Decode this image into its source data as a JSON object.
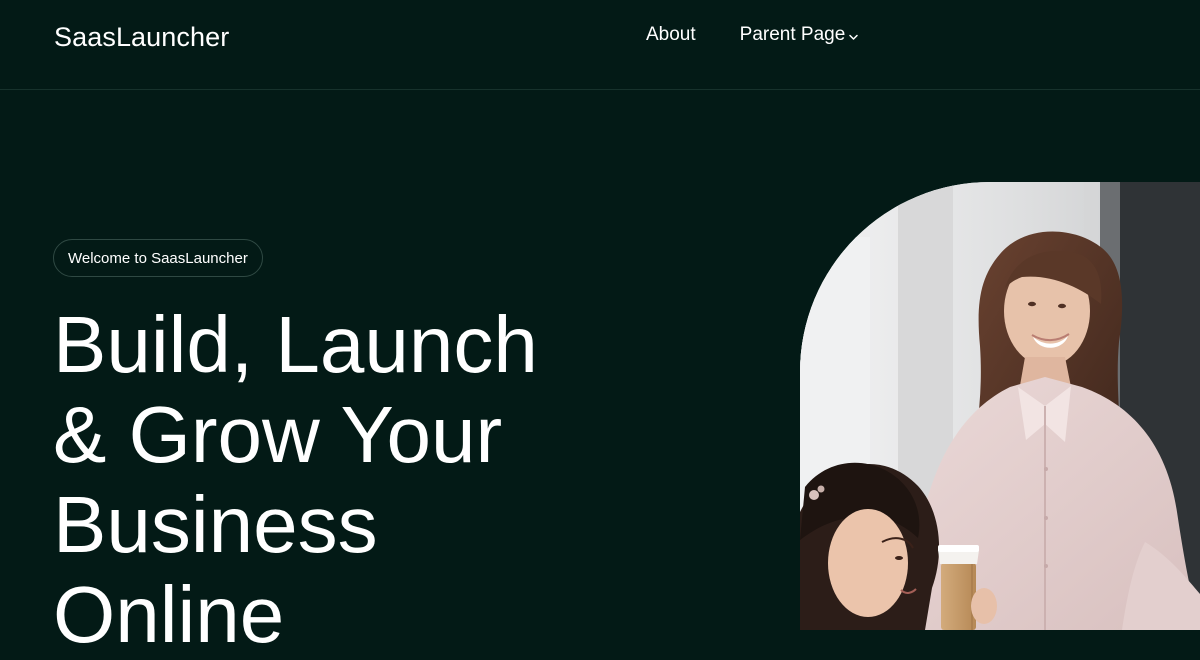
{
  "header": {
    "site_title": "SaasLauncher",
    "nav": [
      {
        "label": "About"
      },
      {
        "label": "Parent Page",
        "icon": "chevron-down-icon"
      }
    ]
  },
  "hero": {
    "welcome_badge": "Welcome to SaasLauncher",
    "headline": "Build, Launch\n& Grow Your\nBusiness\nOnline",
    "image_alt": "Two smiling women talking in an office, one holding a coffee cup"
  },
  "colors": {
    "background": "#031a16",
    "text": "#ffffff",
    "divider": "#17322c",
    "badge_border": "#2f4943"
  }
}
